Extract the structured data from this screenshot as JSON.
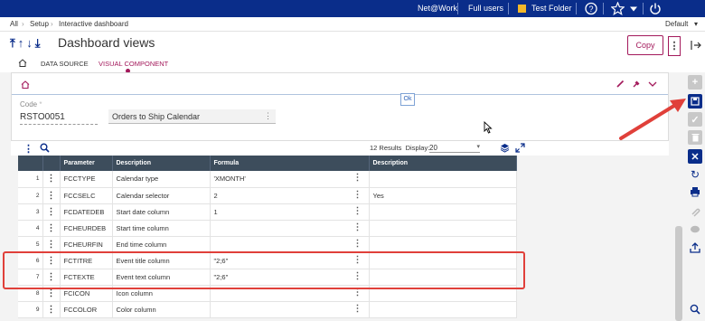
{
  "topbar": {
    "user": "Net@Work",
    "role": "Full users",
    "folder": "Test Folder",
    "icons": [
      "help-icon",
      "star-icon",
      "caret-down-icon",
      "power-icon"
    ]
  },
  "breadcrumb": {
    "items": [
      "All",
      "Setup",
      "Interactive dashboard"
    ],
    "default_label": "Default"
  },
  "header": {
    "title": "Dashboard views",
    "tabs": [
      "DATA SOURCE",
      "VISUAL COMPONENT"
    ],
    "copy_label": "Copy",
    "more_label": "⋮"
  },
  "form": {
    "ok_label": "Ok",
    "code_label": "Code",
    "code_value": "RSTO0051",
    "description_value": "Orders to Ship Calendar"
  },
  "grid": {
    "results": "12 Results",
    "display_label": "Display:",
    "display_value": "20",
    "columns": [
      "",
      "",
      "Parameter",
      "Description",
      "Formula",
      "Description"
    ],
    "rows": [
      {
        "n": "1",
        "parameter": "FCCTYPE",
        "description": "Calendar type",
        "formula": "'XMONTH'",
        "description2": ""
      },
      {
        "n": "2",
        "parameter": "FCCSELC",
        "description": "Calendar selector",
        "formula": "2",
        "description2": "Yes"
      },
      {
        "n": "3",
        "parameter": "FCDATEDEB",
        "description": "Start date column",
        "formula": "1",
        "description2": ""
      },
      {
        "n": "4",
        "parameter": "FCHEURDEB",
        "description": "Start time column",
        "formula": "",
        "description2": ""
      },
      {
        "n": "5",
        "parameter": "FCHEURFIN",
        "description": "End time column",
        "formula": "",
        "description2": ""
      },
      {
        "n": "6",
        "parameter": "FCTITRE",
        "description": "Event title column",
        "formula": "\"2;6\"",
        "description2": ""
      },
      {
        "n": "7",
        "parameter": "FCTEXTE",
        "description": "Event text column",
        "formula": "\"2;6\"",
        "description2": ""
      },
      {
        "n": "8",
        "parameter": "FCICON",
        "description": "Icon column",
        "formula": "",
        "description2": ""
      },
      {
        "n": "9",
        "parameter": "FCCOLOR",
        "description": "Color column",
        "formula": "",
        "description2": ""
      }
    ]
  },
  "colors": {
    "topbar": "#0a2d8a",
    "accent": "#a3195b",
    "highlight": "#e0403a",
    "table_header": "#3d4d5c"
  }
}
